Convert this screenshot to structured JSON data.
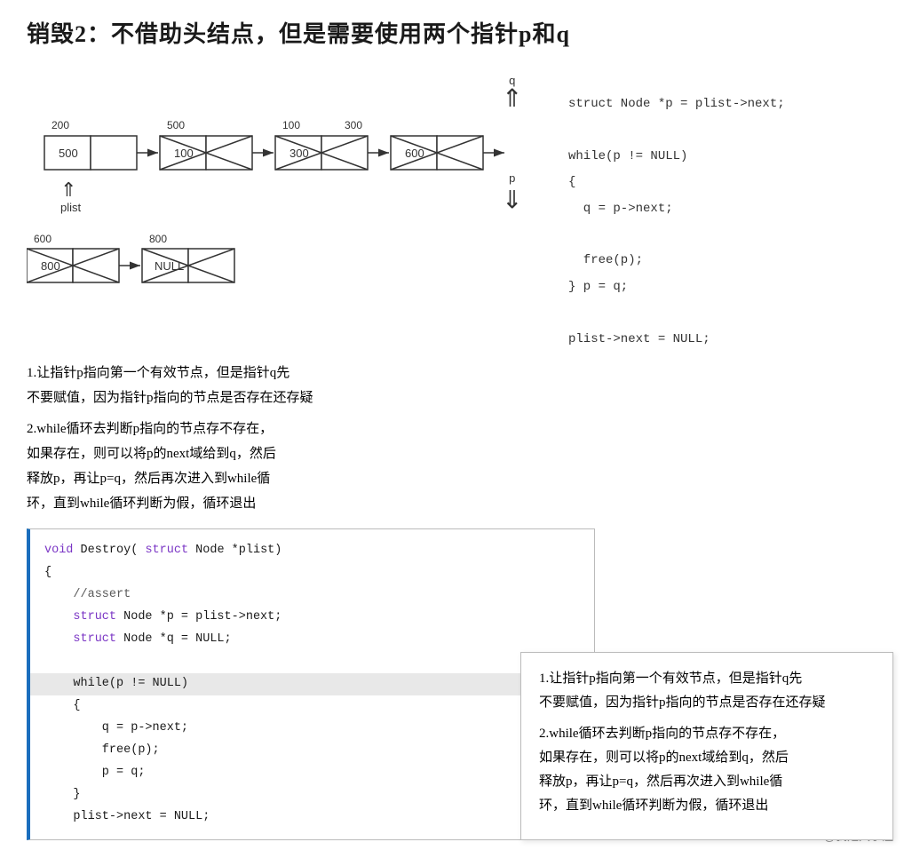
{
  "title": "销毁2：不借助头结点，但是需要使用两个指针p和q",
  "diagram": {
    "nodes": [
      {
        "top": "200",
        "bottom": "500",
        "deleted": false
      },
      {
        "top": "500",
        "bottom": "100",
        "deleted": true
      },
      {
        "top": "100",
        "bottom": "300",
        "deleted": true
      },
      {
        "top": "300",
        "bottom": "600",
        "deleted": true
      },
      {
        "top": "600",
        "bottom": "800",
        "deleted": true
      },
      {
        "top": "800",
        "bottom": "NULL",
        "deleted": true
      }
    ],
    "plist_label": "plist",
    "q_label": "q",
    "p_label": "p"
  },
  "right_code": {
    "lines": [
      "struct Node *p = plist->next;",
      "",
      "while(p != NULL)",
      "{",
      "    q = p->next;",
      "",
      "    free(p);",
      "} p = q;",
      "",
      "plist->next = NULL;"
    ]
  },
  "explanations": [
    {
      "number": "1",
      "text": "让指针p指向第一个有效节点，但是指针q先不要赋值，因为指针p指向的节点是否存在还存疑"
    },
    {
      "number": "2",
      "text": "while循环去判断p指向的节点存不存在，如果存在，则可以将p的next域给到q，然后释放p，再让p=q，然后再次进入到while循环，直到while循环判断为假，循环退出"
    }
  ],
  "code_block": {
    "lines": [
      {
        "text": "void Destroy(struct Node *plist)",
        "type": "normal"
      },
      {
        "text": "{",
        "type": "normal"
      },
      {
        "text": "    //assert",
        "type": "comment"
      },
      {
        "text": "    struct Node *p = plist->next;",
        "type": "normal"
      },
      {
        "text": "    struct Node *q = NULL;",
        "type": "normal"
      },
      {
        "text": "",
        "type": "normal"
      },
      {
        "text": "    while(p != NULL)",
        "type": "highlight"
      },
      {
        "text": "    {",
        "type": "normal"
      },
      {
        "text": "        q = p->next;",
        "type": "normal"
      },
      {
        "text": "        free(p);",
        "type": "normal"
      },
      {
        "text": "        p = q;",
        "type": "normal"
      },
      {
        "text": "    }",
        "type": "normal"
      },
      {
        "text": "    plist->next = NULL;",
        "type": "normal"
      }
    ]
  },
  "popup": {
    "items": [
      {
        "number": "1",
        "text": "让指针p指向第一个有效节点，但是指针q先不要赋值，因为指针p指向的节点是否存在还存疑"
      },
      {
        "number": "2",
        "text": "while循环去判断p指向的节点存不存在，如果存在，则可以将p的next域给到q，然后释放p，再让p=q，然后再次进入到while循环，直到while循环判断为假，循环退出"
      }
    ]
  },
  "footer": "CSDN @我是大学渣"
}
